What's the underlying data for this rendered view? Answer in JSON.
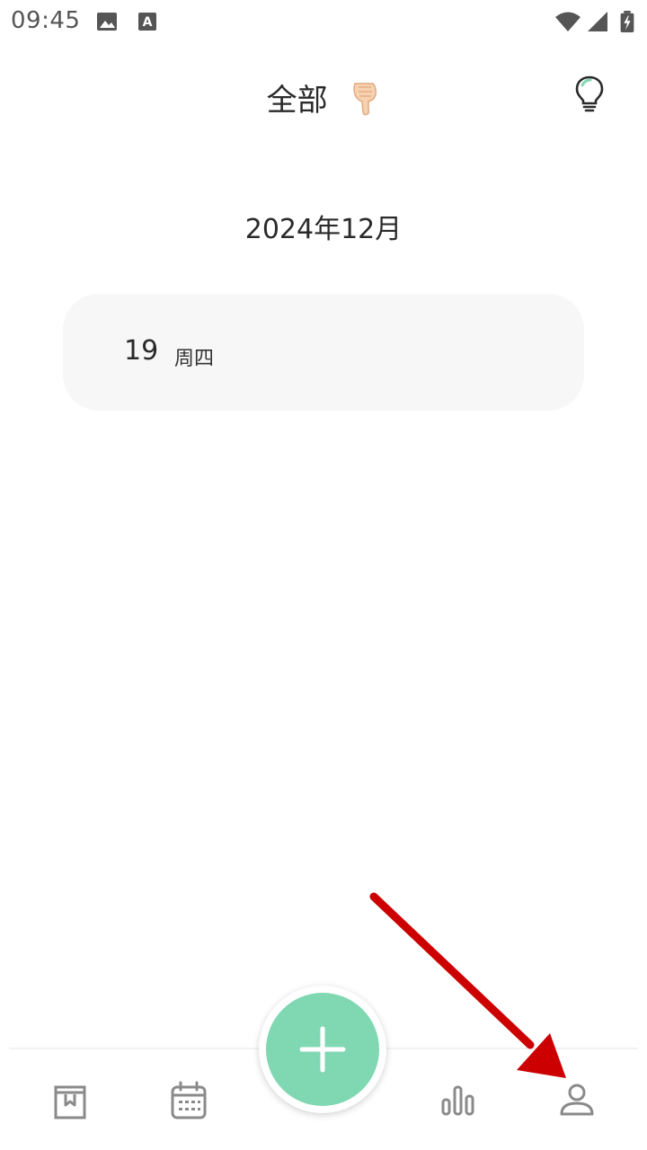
{
  "status_bar": {
    "time": "09:45",
    "icons": [
      "image-notification-icon",
      "font-notification-icon",
      "wifi-icon",
      "signal-icon",
      "battery-charging-icon"
    ]
  },
  "header": {
    "title": "全部",
    "title_icon": "pointing-down-finger-icon",
    "action_icon": "lightbulb-icon"
  },
  "month": {
    "label": "2024年12月"
  },
  "day_entries": [
    {
      "day": "19",
      "weekday": "周四"
    }
  ],
  "bottom_nav": {
    "items": [
      "diary-book-icon",
      "calendar-icon",
      "add-icon",
      "stats-bar-icon",
      "profile-icon"
    ],
    "fab_color": "#80d8b3"
  },
  "annotation": {
    "type": "arrow",
    "color": "#cc0000",
    "points_to": "profile-icon"
  }
}
